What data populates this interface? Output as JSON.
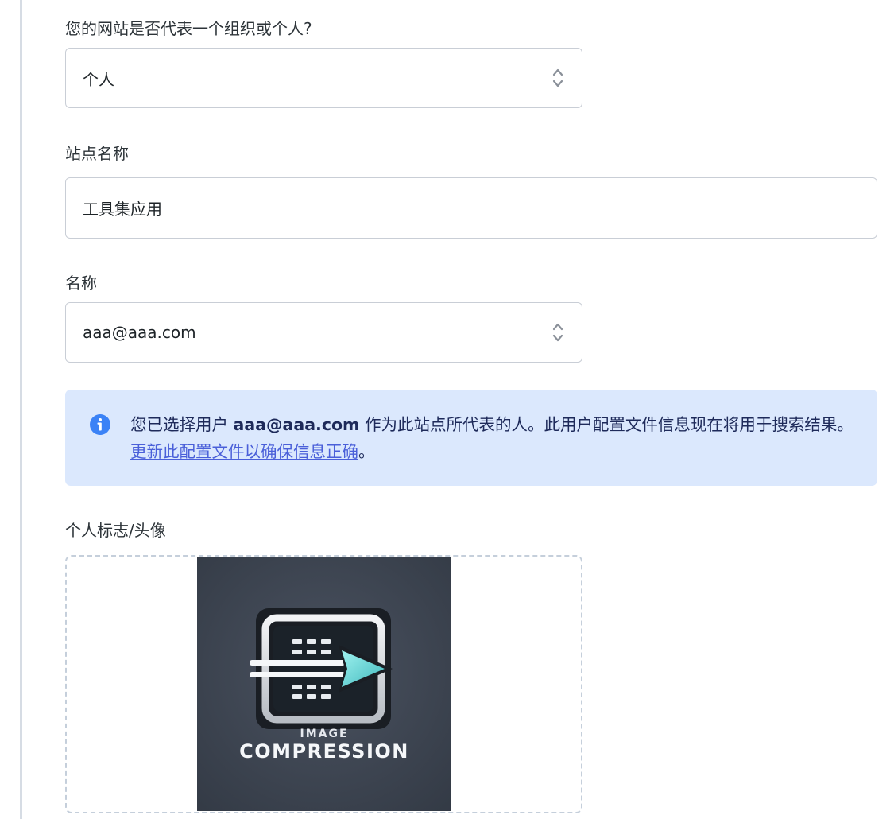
{
  "org_question": {
    "label": "您的网站是否代表一个组织或个人?",
    "value": "个人"
  },
  "site_name": {
    "label": "站点名称",
    "value": "工具集应用"
  },
  "person": {
    "label": "名称",
    "value": "aaa@aaa.com"
  },
  "notice": {
    "prefix": "您已选择用户 ",
    "user": "aaa@aaa.com",
    "middle": " 作为此站点所代表的人。此用户配置文件信息现在将用于搜索结果。 ",
    "link": "更新此配置文件以确保信息正确",
    "suffix": "。",
    "icon": "info-icon"
  },
  "logo": {
    "label": "个人标志/头像",
    "image_text_small": "IMAGE",
    "image_text_large": "COMPRESSION"
  },
  "colors": {
    "notice_bg": "#dbe8fd",
    "info_icon": "#3b82f6",
    "link": "#4a5fd9",
    "border": "#c9ced6"
  }
}
